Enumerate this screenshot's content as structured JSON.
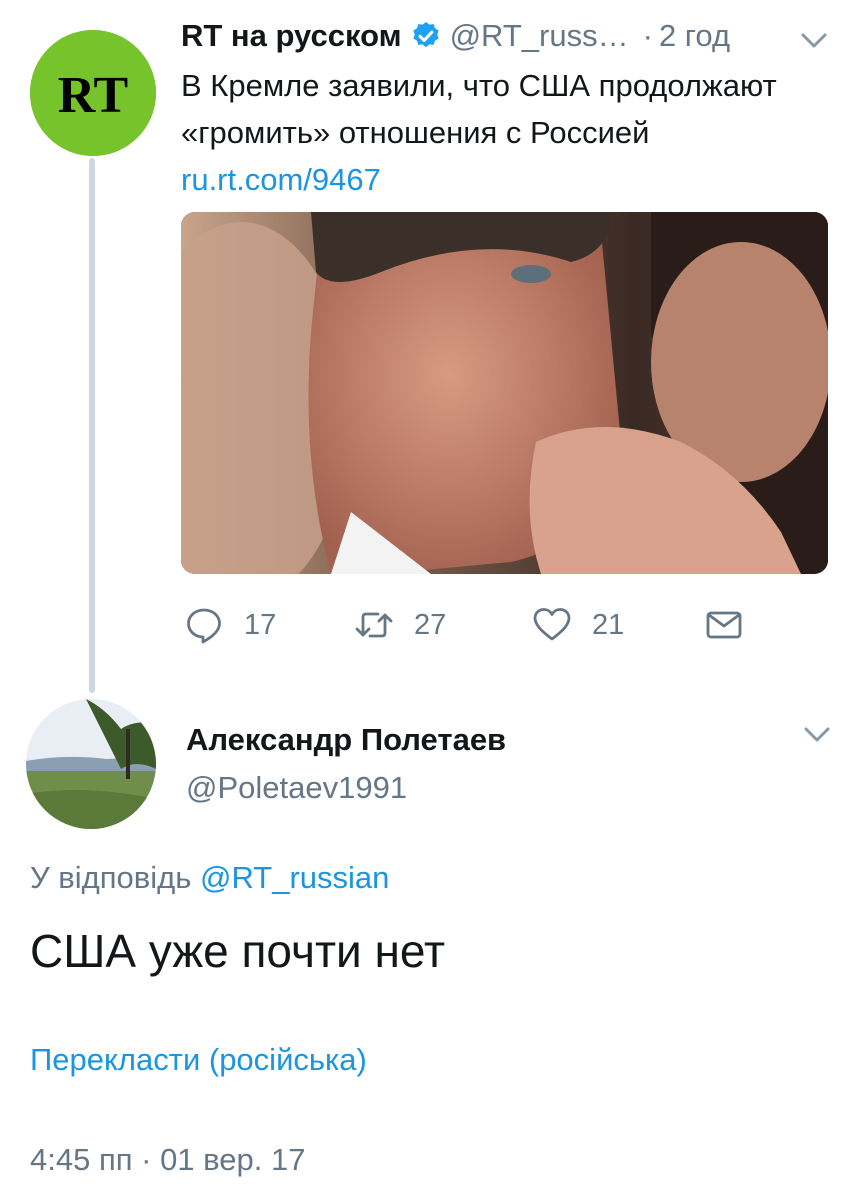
{
  "parent_tweet": {
    "avatar_logo": "RT",
    "author_name": "RT на русском",
    "verified_icon": "verified-badge-icon",
    "handle": "@RT_russ…",
    "separator": "·",
    "time": "2 год",
    "text": "В Кремле заявили, что США продолжают «громить» отношения с Россией",
    "link": "ru.rt.com/9467",
    "actions": {
      "reply_count": "17",
      "retweet_count": "27",
      "like_count": "21"
    }
  },
  "reply_tweet": {
    "author_name": "Александр Полетаев",
    "handle": "@Poletaev1991",
    "reply_to_prefix": "У відповідь",
    "reply_to_handle": "@RT_russian",
    "text": "США уже почти нет",
    "translate_label": "Перекласти (російська)",
    "timestamp": "4:45 пп · 01 вер. 17"
  },
  "colors": {
    "link": "#1b95e0",
    "secondary_text": "#657786",
    "primary_text": "#14171a",
    "rt_brand": "#77c32c",
    "thread_line": "#cdd7df"
  }
}
